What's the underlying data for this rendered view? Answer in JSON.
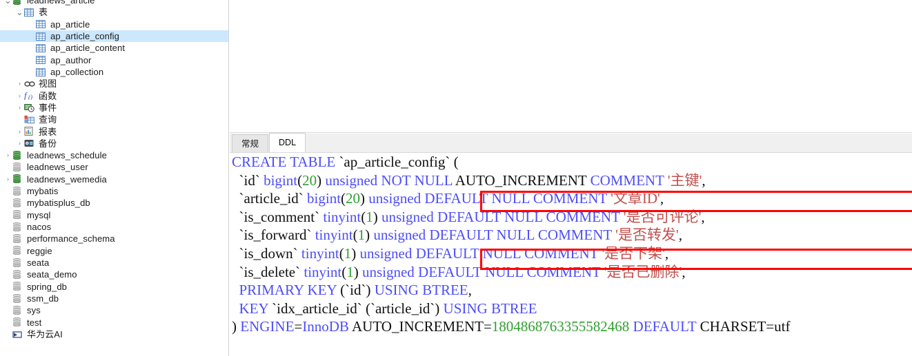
{
  "sidebar": {
    "items": [
      {
        "label": "leadnews_article",
        "indent": 0,
        "twisty": "down",
        "icon": "database-green-icon",
        "selected": false,
        "clipped_top": true
      },
      {
        "label": "表",
        "indent": 1,
        "twisty": "down",
        "icon": "table-folder-icon",
        "selected": false
      },
      {
        "label": "ap_article",
        "indent": 2,
        "twisty": "none",
        "icon": "table-icon",
        "selected": false
      },
      {
        "label": "ap_article_config",
        "indent": 2,
        "twisty": "none",
        "icon": "table-icon",
        "selected": true
      },
      {
        "label": "ap_article_content",
        "indent": 2,
        "twisty": "none",
        "icon": "table-icon",
        "selected": false
      },
      {
        "label": "ap_author",
        "indent": 2,
        "twisty": "none",
        "icon": "table-icon",
        "selected": false
      },
      {
        "label": "ap_collection",
        "indent": 2,
        "twisty": "none",
        "icon": "table-icon",
        "selected": false
      },
      {
        "label": "视图",
        "indent": 1,
        "twisty": "right",
        "icon": "view-icon",
        "selected": false
      },
      {
        "label": "函数",
        "indent": 1,
        "twisty": "right",
        "icon": "function-icon",
        "selected": false
      },
      {
        "label": "事件",
        "indent": 1,
        "twisty": "right",
        "icon": "event-icon",
        "selected": false
      },
      {
        "label": "查询",
        "indent": 1,
        "twisty": "none",
        "icon": "query-icon",
        "selected": false
      },
      {
        "label": "报表",
        "indent": 1,
        "twisty": "right",
        "icon": "report-icon",
        "selected": false
      },
      {
        "label": "备份",
        "indent": 1,
        "twisty": "right",
        "icon": "backup-icon",
        "selected": false
      },
      {
        "label": "leadnews_schedule",
        "indent": 0,
        "twisty": "right",
        "icon": "database-green-icon",
        "selected": false
      },
      {
        "label": "leadnews_user",
        "indent": 0,
        "twisty": "none",
        "icon": "database-gray-icon",
        "selected": false
      },
      {
        "label": "leadnews_wemedia",
        "indent": 0,
        "twisty": "right",
        "icon": "database-green-icon",
        "selected": false
      },
      {
        "label": "mybatis",
        "indent": 0,
        "twisty": "none",
        "icon": "database-gray-icon",
        "selected": false
      },
      {
        "label": "mybatisplus_db",
        "indent": 0,
        "twisty": "none",
        "icon": "database-gray-icon",
        "selected": false
      },
      {
        "label": "mysql",
        "indent": 0,
        "twisty": "none",
        "icon": "database-gray-icon",
        "selected": false
      },
      {
        "label": "nacos",
        "indent": 0,
        "twisty": "none",
        "icon": "database-gray-icon",
        "selected": false
      },
      {
        "label": "performance_schema",
        "indent": 0,
        "twisty": "none",
        "icon": "database-gray-icon",
        "selected": false
      },
      {
        "label": "reggie",
        "indent": 0,
        "twisty": "none",
        "icon": "database-gray-icon",
        "selected": false
      },
      {
        "label": "seata",
        "indent": 0,
        "twisty": "none",
        "icon": "database-gray-icon",
        "selected": false
      },
      {
        "label": "seata_demo",
        "indent": 0,
        "twisty": "none",
        "icon": "database-gray-icon",
        "selected": false
      },
      {
        "label": "spring_db",
        "indent": 0,
        "twisty": "none",
        "icon": "database-gray-icon",
        "selected": false
      },
      {
        "label": "ssm_db",
        "indent": 0,
        "twisty": "none",
        "icon": "database-gray-icon",
        "selected": false
      },
      {
        "label": "sys",
        "indent": 0,
        "twisty": "none",
        "icon": "database-gray-icon",
        "selected": false
      },
      {
        "label": "test",
        "indent": 0,
        "twisty": "none",
        "icon": "database-gray-icon",
        "selected": false
      },
      {
        "label": "华为云AI",
        "indent": 0,
        "twisty": "none",
        "icon": "cloud-icon",
        "selected": false,
        "clipped_bottom": true
      }
    ]
  },
  "tabs": [
    {
      "label": "常规",
      "active": false
    },
    {
      "label": "DDL",
      "active": true
    }
  ],
  "editor": {
    "lines": [
      [
        {
          "t": "CREATE TABLE ",
          "c": "kw"
        },
        {
          "t": "`ap_article_config` (",
          "c": "plain"
        }
      ],
      [
        {
          "t": "  `id` ",
          "c": "plain"
        },
        {
          "t": "bigint",
          "c": "kw"
        },
        {
          "t": "(",
          "c": "plain"
        },
        {
          "t": "20",
          "c": "num"
        },
        {
          "t": ") ",
          "c": "plain"
        },
        {
          "t": "unsigned NOT NULL",
          "c": "kw"
        },
        {
          "t": " AUTO_INCREMENT ",
          "c": "plain"
        },
        {
          "t": "COMMENT",
          "c": "kw"
        },
        {
          "t": " ",
          "c": "plain"
        },
        {
          "t": "'主键'",
          "c": "str"
        },
        {
          "t": ",",
          "c": "plain"
        }
      ],
      [
        {
          "t": "  `article_id` ",
          "c": "plain"
        },
        {
          "t": "bigint",
          "c": "kw"
        },
        {
          "t": "(",
          "c": "plain"
        },
        {
          "t": "20",
          "c": "num"
        },
        {
          "t": ") ",
          "c": "plain"
        },
        {
          "t": "unsigned DEFAULT NULL COMMENT",
          "c": "kw"
        },
        {
          "t": " ",
          "c": "plain"
        },
        {
          "t": "'文章ID'",
          "c": "str"
        },
        {
          "t": ",",
          "c": "plain"
        }
      ],
      [
        {
          "t": "  `is_comment` ",
          "c": "plain"
        },
        {
          "t": "tinyint",
          "c": "kw"
        },
        {
          "t": "(",
          "c": "plain"
        },
        {
          "t": "1",
          "c": "num"
        },
        {
          "t": ") ",
          "c": "plain"
        },
        {
          "t": "unsigned DEFAULT NULL COMMENT",
          "c": "kw"
        },
        {
          "t": " ",
          "c": "plain"
        },
        {
          "t": "'是否可评论'",
          "c": "str"
        },
        {
          "t": ",",
          "c": "plain"
        }
      ],
      [
        {
          "t": "  `is_forward` ",
          "c": "plain"
        },
        {
          "t": "tinyint",
          "c": "kw"
        },
        {
          "t": "(",
          "c": "plain"
        },
        {
          "t": "1",
          "c": "num"
        },
        {
          "t": ") ",
          "c": "plain"
        },
        {
          "t": "unsigned DEFAULT NULL COMMENT",
          "c": "kw"
        },
        {
          "t": " ",
          "c": "plain"
        },
        {
          "t": "'是否转发'",
          "c": "str"
        },
        {
          "t": ",",
          "c": "plain"
        }
      ],
      [
        {
          "t": "  `is_down` ",
          "c": "plain"
        },
        {
          "t": "tinyint",
          "c": "kw"
        },
        {
          "t": "(",
          "c": "plain"
        },
        {
          "t": "1",
          "c": "num"
        },
        {
          "t": ") ",
          "c": "plain"
        },
        {
          "t": "unsigned DEFAULT NULL COMMENT",
          "c": "kw"
        },
        {
          "t": " ",
          "c": "plain"
        },
        {
          "t": "'是否下架'",
          "c": "str"
        },
        {
          "t": ",",
          "c": "plain"
        }
      ],
      [
        {
          "t": "  `is_delete` ",
          "c": "plain"
        },
        {
          "t": "tinyint",
          "c": "kw"
        },
        {
          "t": "(",
          "c": "plain"
        },
        {
          "t": "1",
          "c": "num"
        },
        {
          "t": ") ",
          "c": "plain"
        },
        {
          "t": "unsigned DEFAULT NULL COMMENT",
          "c": "kw"
        },
        {
          "t": " ",
          "c": "plain"
        },
        {
          "t": "'是否已删除'",
          "c": "str"
        },
        {
          "t": ",",
          "c": "plain"
        }
      ],
      [
        {
          "t": "  PRIMARY KEY",
          "c": "kw"
        },
        {
          "t": " (`id`) ",
          "c": "plain"
        },
        {
          "t": "USING BTREE",
          "c": "kw"
        },
        {
          "t": ",",
          "c": "plain"
        }
      ],
      [
        {
          "t": "  KEY",
          "c": "kw"
        },
        {
          "t": " `idx_article_id` (`article_id`) ",
          "c": "plain"
        },
        {
          "t": "USING BTREE",
          "c": "kw"
        }
      ],
      [
        {
          "t": ") ",
          "c": "plain"
        },
        {
          "t": "ENGINE",
          "c": "kw"
        },
        {
          "t": "=",
          "c": "plain"
        },
        {
          "t": "InnoDB",
          "c": "kw"
        },
        {
          "t": " AUTO_INCREMENT=",
          "c": "plain"
        },
        {
          "t": "1804868763355582468",
          "c": "num"
        },
        {
          "t": " ",
          "c": "plain"
        },
        {
          "t": "DEFAULT",
          "c": "kw"
        },
        {
          "t": " CHARSET=utf",
          "c": "plain"
        }
      ]
    ]
  },
  "annotations": [
    {
      "name": "highlight-article-id-line",
      "color": "#ff0000",
      "targets_line": "`article_id` bigint(20) unsigned DEFAULT NULL COMMENT '文章ID',"
    },
    {
      "name": "highlight-is-down-line",
      "color": "#ff0000",
      "targets_line": "`is_down` tinyint(1) unsigned DEFAULT NULL COMMENT '是否下架',"
    }
  ],
  "colors": {
    "keyword": "#4d4dfa",
    "number": "#2f9e2f",
    "string": "#c0504d",
    "selection": "#cce8ff",
    "annotation": "#ff0000"
  }
}
